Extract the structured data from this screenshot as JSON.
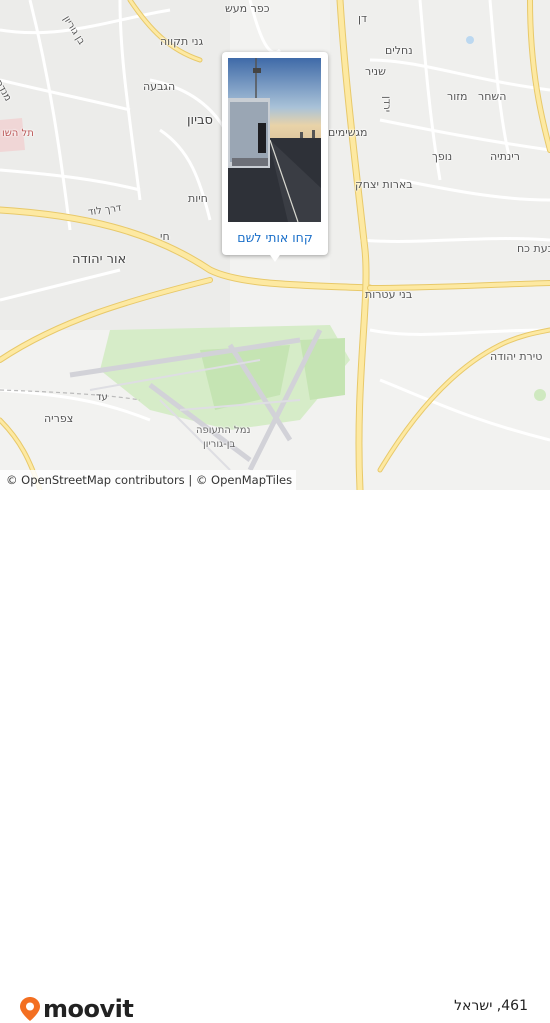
{
  "map": {
    "labels": {
      "kfar_maas": "כפר מעש",
      "dan": "דן",
      "nechalim": "נחלים",
      "ganei_tikva": "גני תקווה",
      "ben_gurion_road": "בן גוריון",
      "haas": "הגבעה",
      "savyon": "סביון",
      "shahar": "השחר",
      "mazor": "מזור",
      "yehud_side": "מגשימים",
      "nofech": "נופך",
      "rinatya": "רינתיה",
      "shanir": "שניר",
      "yarden": "ירדן",
      "barot_yitzhak": "בארות יצחק",
      "hayot": "חיות",
      "derech_lod": "דרך לוד",
      "or_yehuda": "אור יהודה",
      "bnei_atarot": "בני עטרות",
      "tirat_yehuda": "טירת יהודה",
      "ginaton": "בעת כח",
      "tel_hashomer": "תל השו",
      "mendes": "מנדס",
      "tzafria": "צפריה",
      "ad": "עד",
      "ben_gurion_airport_1": "נמל התעופה",
      "ben_gurion_airport_2": "בן-גוריון",
      "hai": "חי"
    },
    "attribution": {
      "osm": "© OpenStreetMap contributors",
      "sep": " | ",
      "omt": "© OpenMapTiles"
    }
  },
  "popup": {
    "cta_label": "קחו אותי לשם",
    "photo_alt": "Stop photo"
  },
  "footer": {
    "brand": "moovit",
    "stop_title": "461, ישראל"
  },
  "colors": {
    "road_major": "#fde9a2",
    "road_major_border": "#e8c96a",
    "road_minor": "#ffffff",
    "green": "#cfe9c0",
    "background": "#f2f2f0",
    "link": "#1a6fc9",
    "brand_orange": "#f36f21"
  }
}
